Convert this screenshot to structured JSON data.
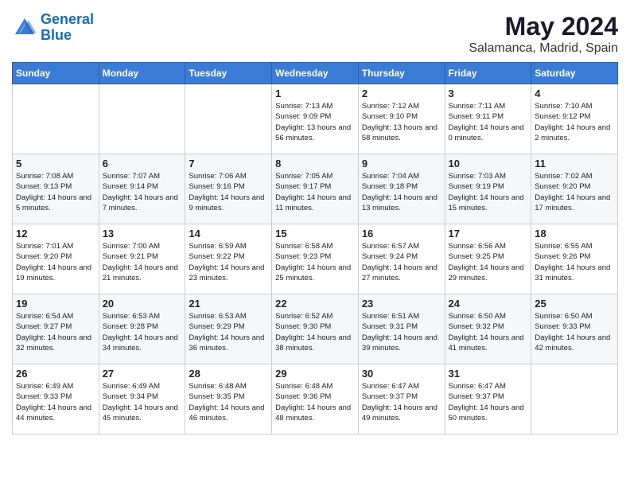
{
  "logo": {
    "line1": "General",
    "line2": "Blue"
  },
  "title": "May 2024",
  "location": "Salamanca, Madrid, Spain",
  "weekdays": [
    "Sunday",
    "Monday",
    "Tuesday",
    "Wednesday",
    "Thursday",
    "Friday",
    "Saturday"
  ],
  "weeks": [
    [
      {
        "day": "",
        "sunrise": "",
        "sunset": "",
        "daylight": ""
      },
      {
        "day": "",
        "sunrise": "",
        "sunset": "",
        "daylight": ""
      },
      {
        "day": "",
        "sunrise": "",
        "sunset": "",
        "daylight": ""
      },
      {
        "day": "1",
        "sunrise": "Sunrise: 7:13 AM",
        "sunset": "Sunset: 9:09 PM",
        "daylight": "Daylight: 13 hours and 56 minutes."
      },
      {
        "day": "2",
        "sunrise": "Sunrise: 7:12 AM",
        "sunset": "Sunset: 9:10 PM",
        "daylight": "Daylight: 13 hours and 58 minutes."
      },
      {
        "day": "3",
        "sunrise": "Sunrise: 7:11 AM",
        "sunset": "Sunset: 9:11 PM",
        "daylight": "Daylight: 14 hours and 0 minutes."
      },
      {
        "day": "4",
        "sunrise": "Sunrise: 7:10 AM",
        "sunset": "Sunset: 9:12 PM",
        "daylight": "Daylight: 14 hours and 2 minutes."
      }
    ],
    [
      {
        "day": "5",
        "sunrise": "Sunrise: 7:08 AM",
        "sunset": "Sunset: 9:13 PM",
        "daylight": "Daylight: 14 hours and 5 minutes."
      },
      {
        "day": "6",
        "sunrise": "Sunrise: 7:07 AM",
        "sunset": "Sunset: 9:14 PM",
        "daylight": "Daylight: 14 hours and 7 minutes."
      },
      {
        "day": "7",
        "sunrise": "Sunrise: 7:06 AM",
        "sunset": "Sunset: 9:16 PM",
        "daylight": "Daylight: 14 hours and 9 minutes."
      },
      {
        "day": "8",
        "sunrise": "Sunrise: 7:05 AM",
        "sunset": "Sunset: 9:17 PM",
        "daylight": "Daylight: 14 hours and 11 minutes."
      },
      {
        "day": "9",
        "sunrise": "Sunrise: 7:04 AM",
        "sunset": "Sunset: 9:18 PM",
        "daylight": "Daylight: 14 hours and 13 minutes."
      },
      {
        "day": "10",
        "sunrise": "Sunrise: 7:03 AM",
        "sunset": "Sunset: 9:19 PM",
        "daylight": "Daylight: 14 hours and 15 minutes."
      },
      {
        "day": "11",
        "sunrise": "Sunrise: 7:02 AM",
        "sunset": "Sunset: 9:20 PM",
        "daylight": "Daylight: 14 hours and 17 minutes."
      }
    ],
    [
      {
        "day": "12",
        "sunrise": "Sunrise: 7:01 AM",
        "sunset": "Sunset: 9:20 PM",
        "daylight": "Daylight: 14 hours and 19 minutes."
      },
      {
        "day": "13",
        "sunrise": "Sunrise: 7:00 AM",
        "sunset": "Sunset: 9:21 PM",
        "daylight": "Daylight: 14 hours and 21 minutes."
      },
      {
        "day": "14",
        "sunrise": "Sunrise: 6:59 AM",
        "sunset": "Sunset: 9:22 PM",
        "daylight": "Daylight: 14 hours and 23 minutes."
      },
      {
        "day": "15",
        "sunrise": "Sunrise: 6:58 AM",
        "sunset": "Sunset: 9:23 PM",
        "daylight": "Daylight: 14 hours and 25 minutes."
      },
      {
        "day": "16",
        "sunrise": "Sunrise: 6:57 AM",
        "sunset": "Sunset: 9:24 PM",
        "daylight": "Daylight: 14 hours and 27 minutes."
      },
      {
        "day": "17",
        "sunrise": "Sunrise: 6:56 AM",
        "sunset": "Sunset: 9:25 PM",
        "daylight": "Daylight: 14 hours and 29 minutes."
      },
      {
        "day": "18",
        "sunrise": "Sunrise: 6:55 AM",
        "sunset": "Sunset: 9:26 PM",
        "daylight": "Daylight: 14 hours and 31 minutes."
      }
    ],
    [
      {
        "day": "19",
        "sunrise": "Sunrise: 6:54 AM",
        "sunset": "Sunset: 9:27 PM",
        "daylight": "Daylight: 14 hours and 32 minutes."
      },
      {
        "day": "20",
        "sunrise": "Sunrise: 6:53 AM",
        "sunset": "Sunset: 9:28 PM",
        "daylight": "Daylight: 14 hours and 34 minutes."
      },
      {
        "day": "21",
        "sunrise": "Sunrise: 6:53 AM",
        "sunset": "Sunset: 9:29 PM",
        "daylight": "Daylight: 14 hours and 36 minutes."
      },
      {
        "day": "22",
        "sunrise": "Sunrise: 6:52 AM",
        "sunset": "Sunset: 9:30 PM",
        "daylight": "Daylight: 14 hours and 38 minutes."
      },
      {
        "day": "23",
        "sunrise": "Sunrise: 6:51 AM",
        "sunset": "Sunset: 9:31 PM",
        "daylight": "Daylight: 14 hours and 39 minutes."
      },
      {
        "day": "24",
        "sunrise": "Sunrise: 6:50 AM",
        "sunset": "Sunset: 9:32 PM",
        "daylight": "Daylight: 14 hours and 41 minutes."
      },
      {
        "day": "25",
        "sunrise": "Sunrise: 6:50 AM",
        "sunset": "Sunset: 9:33 PM",
        "daylight": "Daylight: 14 hours and 42 minutes."
      }
    ],
    [
      {
        "day": "26",
        "sunrise": "Sunrise: 6:49 AM",
        "sunset": "Sunset: 9:33 PM",
        "daylight": "Daylight: 14 hours and 44 minutes."
      },
      {
        "day": "27",
        "sunrise": "Sunrise: 6:49 AM",
        "sunset": "Sunset: 9:34 PM",
        "daylight": "Daylight: 14 hours and 45 minutes."
      },
      {
        "day": "28",
        "sunrise": "Sunrise: 6:48 AM",
        "sunset": "Sunset: 9:35 PM",
        "daylight": "Daylight: 14 hours and 46 minutes."
      },
      {
        "day": "29",
        "sunrise": "Sunrise: 6:48 AM",
        "sunset": "Sunset: 9:36 PM",
        "daylight": "Daylight: 14 hours and 48 minutes."
      },
      {
        "day": "30",
        "sunrise": "Sunrise: 6:47 AM",
        "sunset": "Sunset: 9:37 PM",
        "daylight": "Daylight: 14 hours and 49 minutes."
      },
      {
        "day": "31",
        "sunrise": "Sunrise: 6:47 AM",
        "sunset": "Sunset: 9:37 PM",
        "daylight": "Daylight: 14 hours and 50 minutes."
      },
      {
        "day": "",
        "sunrise": "",
        "sunset": "",
        "daylight": ""
      }
    ]
  ]
}
